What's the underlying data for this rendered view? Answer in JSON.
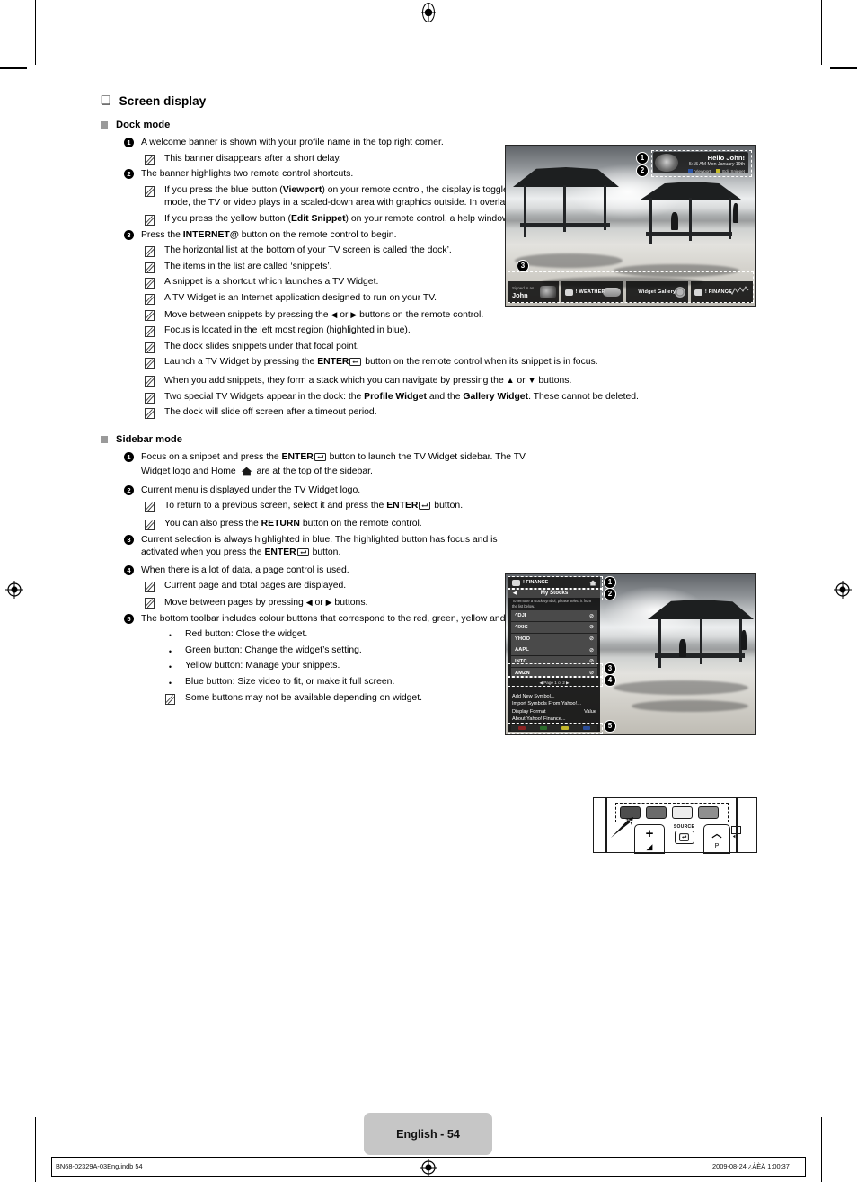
{
  "page": {
    "footer_page_label": "English - 54",
    "footer_left": "BN68-02329A-03Eng.indb   54",
    "footer_right": "2009-08-24   ¿ÀÈÄ 1:00:37"
  },
  "section": {
    "title": "Screen display",
    "marker_glyph": "❏"
  },
  "dock_mode": {
    "heading": "Dock mode",
    "items": [
      {
        "num": "1",
        "text": "A welcome banner is shown with your profile name in the top right corner.",
        "notes": [
          "This banner disappears after a short delay."
        ]
      },
      {
        "num": "2",
        "text": "The banner highlights two remote control shortcuts.",
        "notes": [
          "If you press the blue button (Viewport) on your remote control, the display is toggled between ‘Viewport mode’ and ‘Overlay mode’. In Viewport mode, the TV or video plays in a scaled-down area with graphics outside. In overlay mode, the graphics are displayed on top of the TV or video.",
          "If you press the yellow button (Edit Snippet) on your remote control, a help window is displayed and the snippet with focus can be edited."
        ]
      },
      {
        "num": "3",
        "text": "Press the INTERNET@ button on the remote control to begin.",
        "notes": [
          "The horizontal list at the bottom of your TV screen is called ‘the dock’.",
          "The items in the list are called ‘snippets’.",
          "A snippet is a shortcut which launches a TV Widget.",
          "A TV Widget is an Internet application designed to run on your TV.",
          "Move between snippets by pressing the ◀ or ▶ buttons on the remote control.",
          "Focus is located in the left most region (highlighted in blue).",
          "The dock slides snippets under that focal point.",
          "Launch a TV Widget by pressing the ENTER button on the remote control when its snippet is in focus.",
          "When you add snippets, they form a stack which you can navigate by pressing the ▲ or ▼ buttons.",
          "Two special TV Widgets appear in the dock: the Profile Widget and the Gallery Widget. These cannot be deleted.",
          "The dock will slide off screen after a timeout period."
        ]
      }
    ]
  },
  "sidebar_mode": {
    "heading": "Sidebar mode",
    "items": [
      {
        "num": "1",
        "text": "Focus on a snippet and press the ENTER button to launch the TV Widget sidebar. The TV Widget logo and Home are at the top of the sidebar."
      },
      {
        "num": "2",
        "text": "Current menu is displayed under the TV Widget logo.",
        "notes": [
          "To return to a previous screen, select it and press the ENTER button.",
          "You can also press the RETURN button on the remote control."
        ]
      },
      {
        "num": "3",
        "text": "Current selection is always highlighted in blue. The highlighted button has focus and is activated when you press the ENTER button."
      },
      {
        "num": "4",
        "text": "When there is a lot of data, a page control is used.",
        "notes": [
          "Current page and total pages are displayed.",
          "Move between pages by pressing ◀ or ▶ buttons."
        ]
      },
      {
        "num": "5",
        "text": "The bottom toolbar includes colour buttons that correspond to the red, green, yellow and blue buttons on the remote control.",
        "bullets": [
          "Red button: Close the widget.",
          "Green button: Change the widget’s setting.",
          "Yellow button: Manage your snippets.",
          "Blue button: Size video to fit, or make it full screen."
        ],
        "notes": [
          "Some buttons may not be available depending on widget."
        ]
      }
    ]
  },
  "dock_screenshot": {
    "callouts": [
      "1",
      "2",
      "3"
    ],
    "banner": {
      "greeting": "Hello John!",
      "datetime": "5:15 AM Mon January 19th",
      "key_blue": "Viewport",
      "key_yellow": "Edit Snippet"
    },
    "dock_items": [
      {
        "type": "profile",
        "top_label": "Signed in as",
        "name": "John"
      },
      {
        "type": "widget",
        "label": "! WEATHER"
      },
      {
        "type": "gallery",
        "label": "Widget Gallery"
      },
      {
        "type": "widget",
        "label": "! FINANCE"
      }
    ]
  },
  "sidebar_screenshot": {
    "callouts": [
      "1",
      "2",
      "3",
      "4",
      "5"
    ],
    "widget_title": "! FINANCE",
    "menu_title": "My Stocks",
    "back_glyph": "◀",
    "hint": "To remove a stock symbol, please select it from the list below.",
    "symbols": [
      "^DJI",
      "^IXIC",
      "YHOO",
      "AAPL",
      "INTC",
      "AMZN"
    ],
    "remove_glyph": "⊘",
    "page_control": "◀  Page 1 of 2  ▶",
    "options": [
      {
        "label": "Add New Symbol..."
      },
      {
        "label": "Import Symbols From Yahoo!..."
      },
      {
        "label": "Display Format",
        "value": "Value"
      },
      {
        "label": "About Yahoo! Finance..."
      }
    ],
    "toolbar_colors": [
      "#7a1f1f",
      "#1f5a22",
      "#b9b000",
      "#1f3f8a"
    ]
  },
  "remote_illustration": {
    "source_label": "SOURCE",
    "plus_label": "+",
    "channel_up_glyph": "︿",
    "colour_buttons": [
      "red",
      "green",
      "yellow",
      "blue"
    ]
  }
}
